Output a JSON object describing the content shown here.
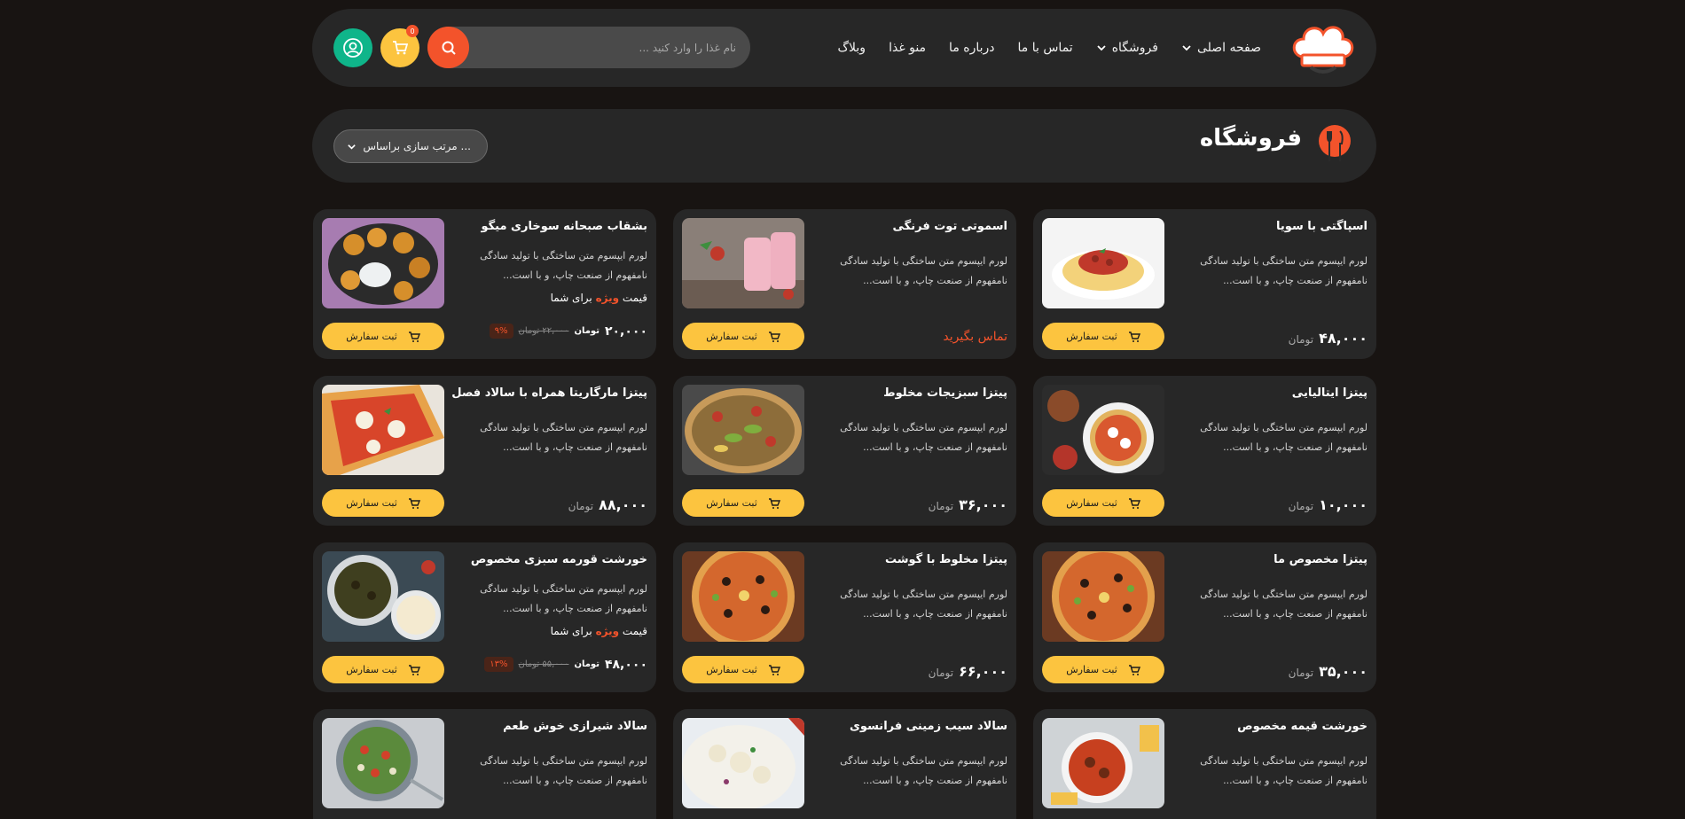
{
  "nav": {
    "items": [
      {
        "label": "صفحه اصلی",
        "dropdown": true
      },
      {
        "label": "فروشگاه",
        "dropdown": true
      },
      {
        "label": "تماس با ما",
        "dropdown": false
      },
      {
        "label": "درباره ما",
        "dropdown": false
      },
      {
        "label": "منو غذا",
        "dropdown": false
      },
      {
        "label": "وبلاگ",
        "dropdown": false
      }
    ]
  },
  "search": {
    "placeholder": "نام غذا را وارد کنید ..."
  },
  "cart": {
    "count": "0"
  },
  "shop": {
    "title": "فروشگاه",
    "sort_label": "مرتب سازی براساس ..."
  },
  "labels": {
    "order": "ثبت سفارش",
    "currency": "تومان",
    "contact": "تماس بگیرید",
    "special_prefix": "قیمت",
    "special_word": "ویژه",
    "special_suffix": "برای شما"
  },
  "products": [
    {
      "title": "اسپاگتی با سویا",
      "desc": "لورم ایپسوم متن ساختگی با تولید سادگی نامفهوم از صنعت چاپ، و با است...",
      "price": "۴۸,۰۰۰",
      "kind": "price"
    },
    {
      "title": "اسموتی توت فرنگی",
      "desc": "لورم ایپسوم متن ساختگی با تولید سادگی نامفهوم از صنعت چاپ، و با است...",
      "kind": "contact"
    },
    {
      "title": "بشقاب صبحانه سوخاری میگو",
      "desc": "لورم ایپسوم متن ساختگی با تولید سادگی نامفهوم از صنعت چاپ، و با است...",
      "kind": "offer",
      "new_price": "۲۰,۰۰۰",
      "old_price": "۲۲,۰۰۰ تومان",
      "discount": "۹%"
    },
    {
      "title": "پیتزا ایتالیایی",
      "desc": "لورم ایپسوم متن ساختگی با تولید سادگی نامفهوم از صنعت چاپ، و با است...",
      "price": "۱۰,۰۰۰",
      "kind": "price"
    },
    {
      "title": "پیتزا سبزیجات مخلوط",
      "desc": "لورم ایپسوم متن ساختگی با تولید سادگی نامفهوم از صنعت چاپ، و با است...",
      "price": "۳۶,۰۰۰",
      "kind": "price"
    },
    {
      "title": "پیتزا مارگاریتا همراه با سالاد فصل",
      "desc": "لورم ایپسوم متن ساختگی با تولید سادگی نامفهوم از صنعت چاپ، و با است...",
      "price": "۸۸,۰۰۰",
      "kind": "price"
    },
    {
      "title": "پیتزا مخصوص ما",
      "desc": "لورم ایپسوم متن ساختگی با تولید سادگی نامفهوم از صنعت چاپ، و با است...",
      "price": "۳۵,۰۰۰",
      "kind": "price"
    },
    {
      "title": "پیتزا مخلوط با گوشت",
      "desc": "لورم ایپسوم متن ساختگی با تولید سادگی نامفهوم از صنعت چاپ، و با است...",
      "price": "۶۶,۰۰۰",
      "kind": "price"
    },
    {
      "title": "خورشت قورمه سبزی مخصوص",
      "desc": "لورم ایپسوم متن ساختگی با تولید سادگی نامفهوم از صنعت چاپ، و با است...",
      "kind": "offer",
      "new_price": "۴۸,۰۰۰",
      "old_price": "۵۵,۰۰۰ تومان",
      "discount": "۱۳%"
    },
    {
      "title": "خورشت قیمه مخصوص",
      "desc": "لورم ایپسوم متن ساختگی با تولید سادگی نامفهوم از صنعت چاپ، و با است...",
      "kind": "none"
    },
    {
      "title": "سالاد سیب زمینی فرانسوی",
      "desc": "لورم ایپسوم متن ساختگی با تولید سادگی نامفهوم از صنعت چاپ، و با است...",
      "kind": "none"
    },
    {
      "title": "سالاد شیرازی خوش طعم",
      "desc": "لورم ایپسوم متن ساختگی با تولید سادگی نامفهوم از صنعت چاپ، و با است...",
      "kind": "none"
    }
  ],
  "colors": {
    "accent": "#f3532b",
    "yellow": "#fcc43f",
    "green": "#0fb58a",
    "card": "#272727",
    "bg": "#181412"
  }
}
